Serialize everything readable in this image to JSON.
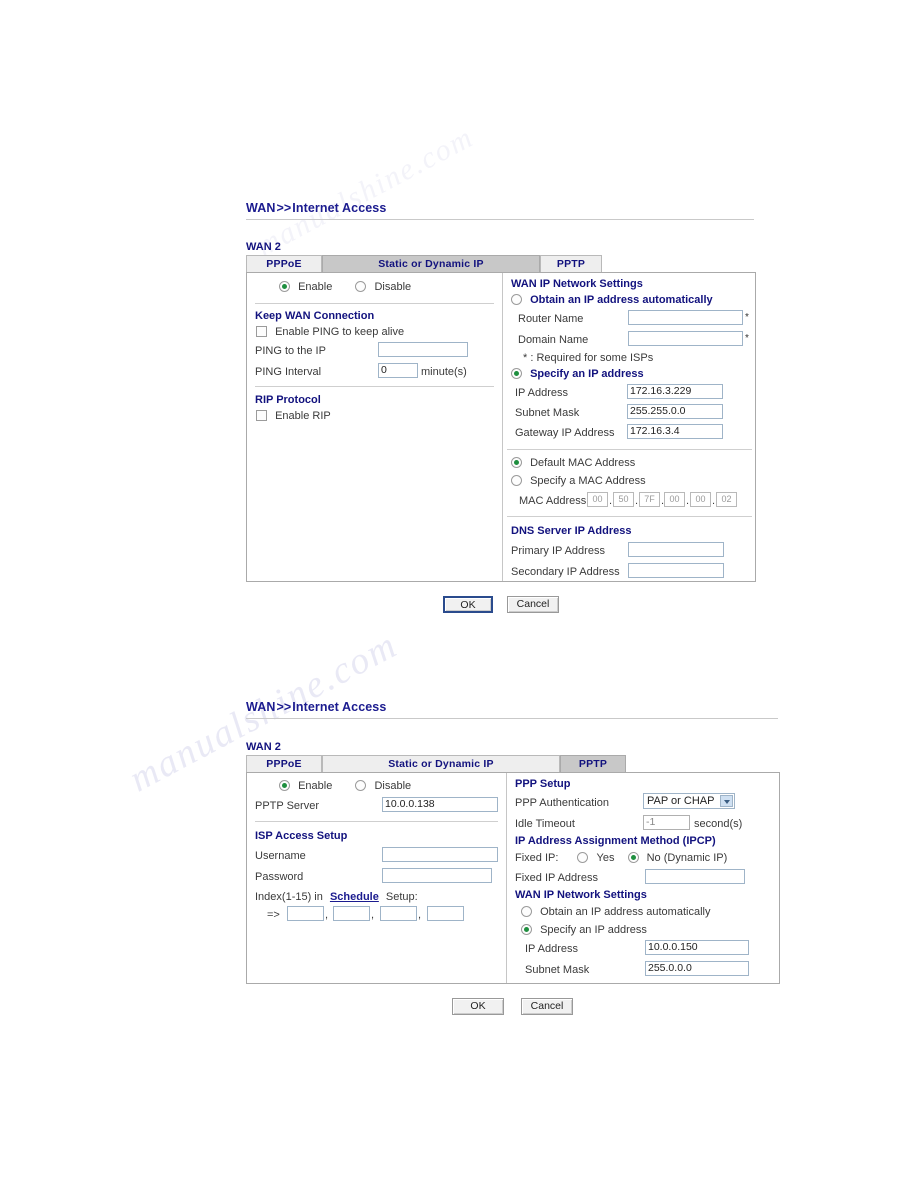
{
  "watermark": {
    "line1": "manualshine.com",
    "line2": "manualshine.com",
    "line3": "manualshine.com"
  },
  "sections": [
    {
      "breadcrumb": {
        "root": "WAN",
        "sep": ">>",
        "leaf": "Internet Access"
      },
      "wan_label": "WAN 2",
      "tabs": [
        {
          "label": "PPPoE",
          "selected": false
        },
        {
          "label": "Static or Dynamic IP",
          "selected": true
        },
        {
          "label": "PPTP",
          "selected": false
        }
      ],
      "left": {
        "enable_label": "Enable",
        "disable_label": "Disable",
        "enable_selected": true,
        "keep_wan_title": "Keep WAN Connection",
        "enable_ping_label": "Enable PING to keep alive",
        "enable_ping_checked": false,
        "ping_ip_label": "PING to the IP",
        "ping_ip_value": "",
        "ping_interval_label": "PING Interval",
        "ping_interval_value": "0",
        "ping_interval_unit": "minute(s)",
        "rip_title": "RIP Protocol",
        "enable_rip_label": "Enable RIP",
        "enable_rip_checked": false
      },
      "right": {
        "wan_ip_title": "WAN IP Network Settings",
        "obtain_auto_label": "Obtain an IP address automatically",
        "obtain_auto_selected": false,
        "router_name_label": "Router Name",
        "router_name_value": "",
        "domain_name_label": "Domain Name",
        "domain_name_value": "",
        "required_note": "* : Required for some ISPs",
        "specify_ip_label": "Specify an IP address",
        "specify_ip_selected": true,
        "ip_address_label": "IP Address",
        "ip_address_value": "172.16.3.229",
        "subnet_mask_label": "Subnet Mask",
        "subnet_mask_value": "255.255.0.0",
        "gateway_label": "Gateway IP Address",
        "gateway_value": "172.16.3.4",
        "default_mac_label": "Default MAC Address",
        "default_mac_selected": true,
        "specify_mac_label": "Specify a MAC Address",
        "specify_mac_selected": false,
        "mac_address_label": "MAC Address:",
        "mac_octets": [
          "00",
          "50",
          "7F",
          "00",
          "00",
          "02"
        ],
        "dns_title": "DNS Server IP Address",
        "primary_dns_label": "Primary IP Address",
        "primary_dns_value": "",
        "secondary_dns_label": "Secondary IP Address",
        "secondary_dns_value": ""
      },
      "buttons": {
        "ok": "OK",
        "cancel": "Cancel"
      }
    },
    {
      "breadcrumb": {
        "root": "WAN",
        "sep": ">>",
        "leaf": "Internet Access"
      },
      "wan_label": "WAN 2",
      "tabs": [
        {
          "label": "PPPoE",
          "selected": false
        },
        {
          "label": "Static or Dynamic IP",
          "selected": false
        },
        {
          "label": "PPTP",
          "selected": true
        }
      ],
      "left": {
        "enable_label": "Enable",
        "disable_label": "Disable",
        "enable_selected": true,
        "pptp_server_label": "PPTP Server",
        "pptp_server_value": "10.0.0.138",
        "isp_title": "ISP Access Setup",
        "username_label": "Username",
        "username_value": "",
        "password_label": "Password",
        "password_value": "",
        "index_prefix": "Index(1-15) in",
        "schedule_link": "Schedule",
        "index_suffix": "Setup:",
        "arrow": "=>",
        "schedule_values": [
          "",
          "",
          "",
          ""
        ]
      },
      "right": {
        "ppp_setup_title": "PPP Setup",
        "ppp_auth_label": "PPP Authentication",
        "ppp_auth_value": "PAP or CHAP",
        "idle_timeout_label": "Idle Timeout",
        "idle_timeout_value": "-1",
        "idle_timeout_unit": "second(s)",
        "ipcp_title": "IP Address Assignment Method (IPCP)",
        "fixed_ip_label": "Fixed IP:",
        "fixed_yes_label": "Yes",
        "fixed_no_label": "No (Dynamic IP)",
        "fixed_yes_selected": false,
        "fixed_no_selected": true,
        "fixed_ip_addr_label": "Fixed IP Address",
        "fixed_ip_addr_value": "",
        "wan_ip_title": "WAN IP Network Settings",
        "obtain_auto_label": "Obtain an IP address automatically",
        "obtain_auto_selected": false,
        "specify_ip_label": "Specify an IP address",
        "specify_ip_selected": true,
        "ip_address_label": "IP Address",
        "ip_address_value": "10.0.0.150",
        "subnet_mask_label": "Subnet Mask",
        "subnet_mask_value": "255.0.0.0"
      },
      "buttons": {
        "ok": "OK",
        "cancel": "Cancel"
      }
    }
  ]
}
